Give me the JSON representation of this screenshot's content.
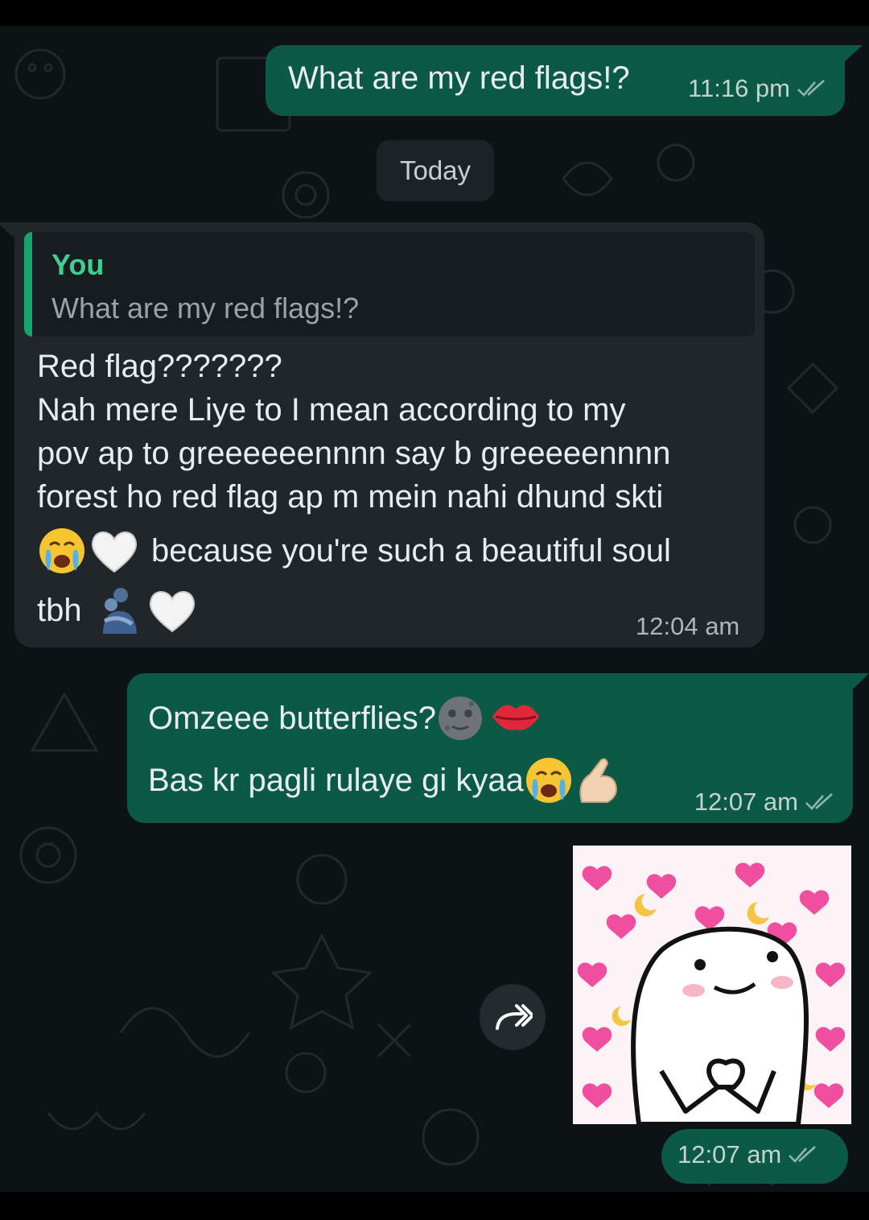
{
  "chat": {
    "date_chip": "Today",
    "messages": [
      {
        "text": "What are my red flags!?",
        "time": "11:16 pm"
      },
      {
        "quote_author": "You",
        "quote_text": "What are my red flags!?",
        "lines": [
          "Red flag???????",
          "Nah mere Liye to I mean according to my",
          "pov ap to greeeeeennnn say b greeeeennnn",
          "forest ho red flag ap m mein nahi dhund skti",
          "because you're such a beautiful soul",
          "tbh"
        ],
        "time": "12:04 am"
      },
      {
        "lines": [
          "Omzeee butterflies?",
          "Bas kr pagli rulaye gi kyaa"
        ],
        "time": "12:07 am"
      },
      {
        "sticker": "flork-heart-hands-sticker",
        "time": "12:07 am"
      }
    ]
  },
  "colors": {
    "outgoing_bubble": "#0b5a45",
    "incoming_bubble": "#202629",
    "read_ticks": "#8fb6ae",
    "quote_author": "#3fcf8e"
  },
  "icons": [
    "double-check-icon",
    "forward-icon",
    "crying-face-emoji",
    "white-heart-emoji",
    "people-hugging-emoji",
    "new-moon-face-emoji",
    "kiss-mark-emoji",
    "pinching-hand-emoji"
  ]
}
